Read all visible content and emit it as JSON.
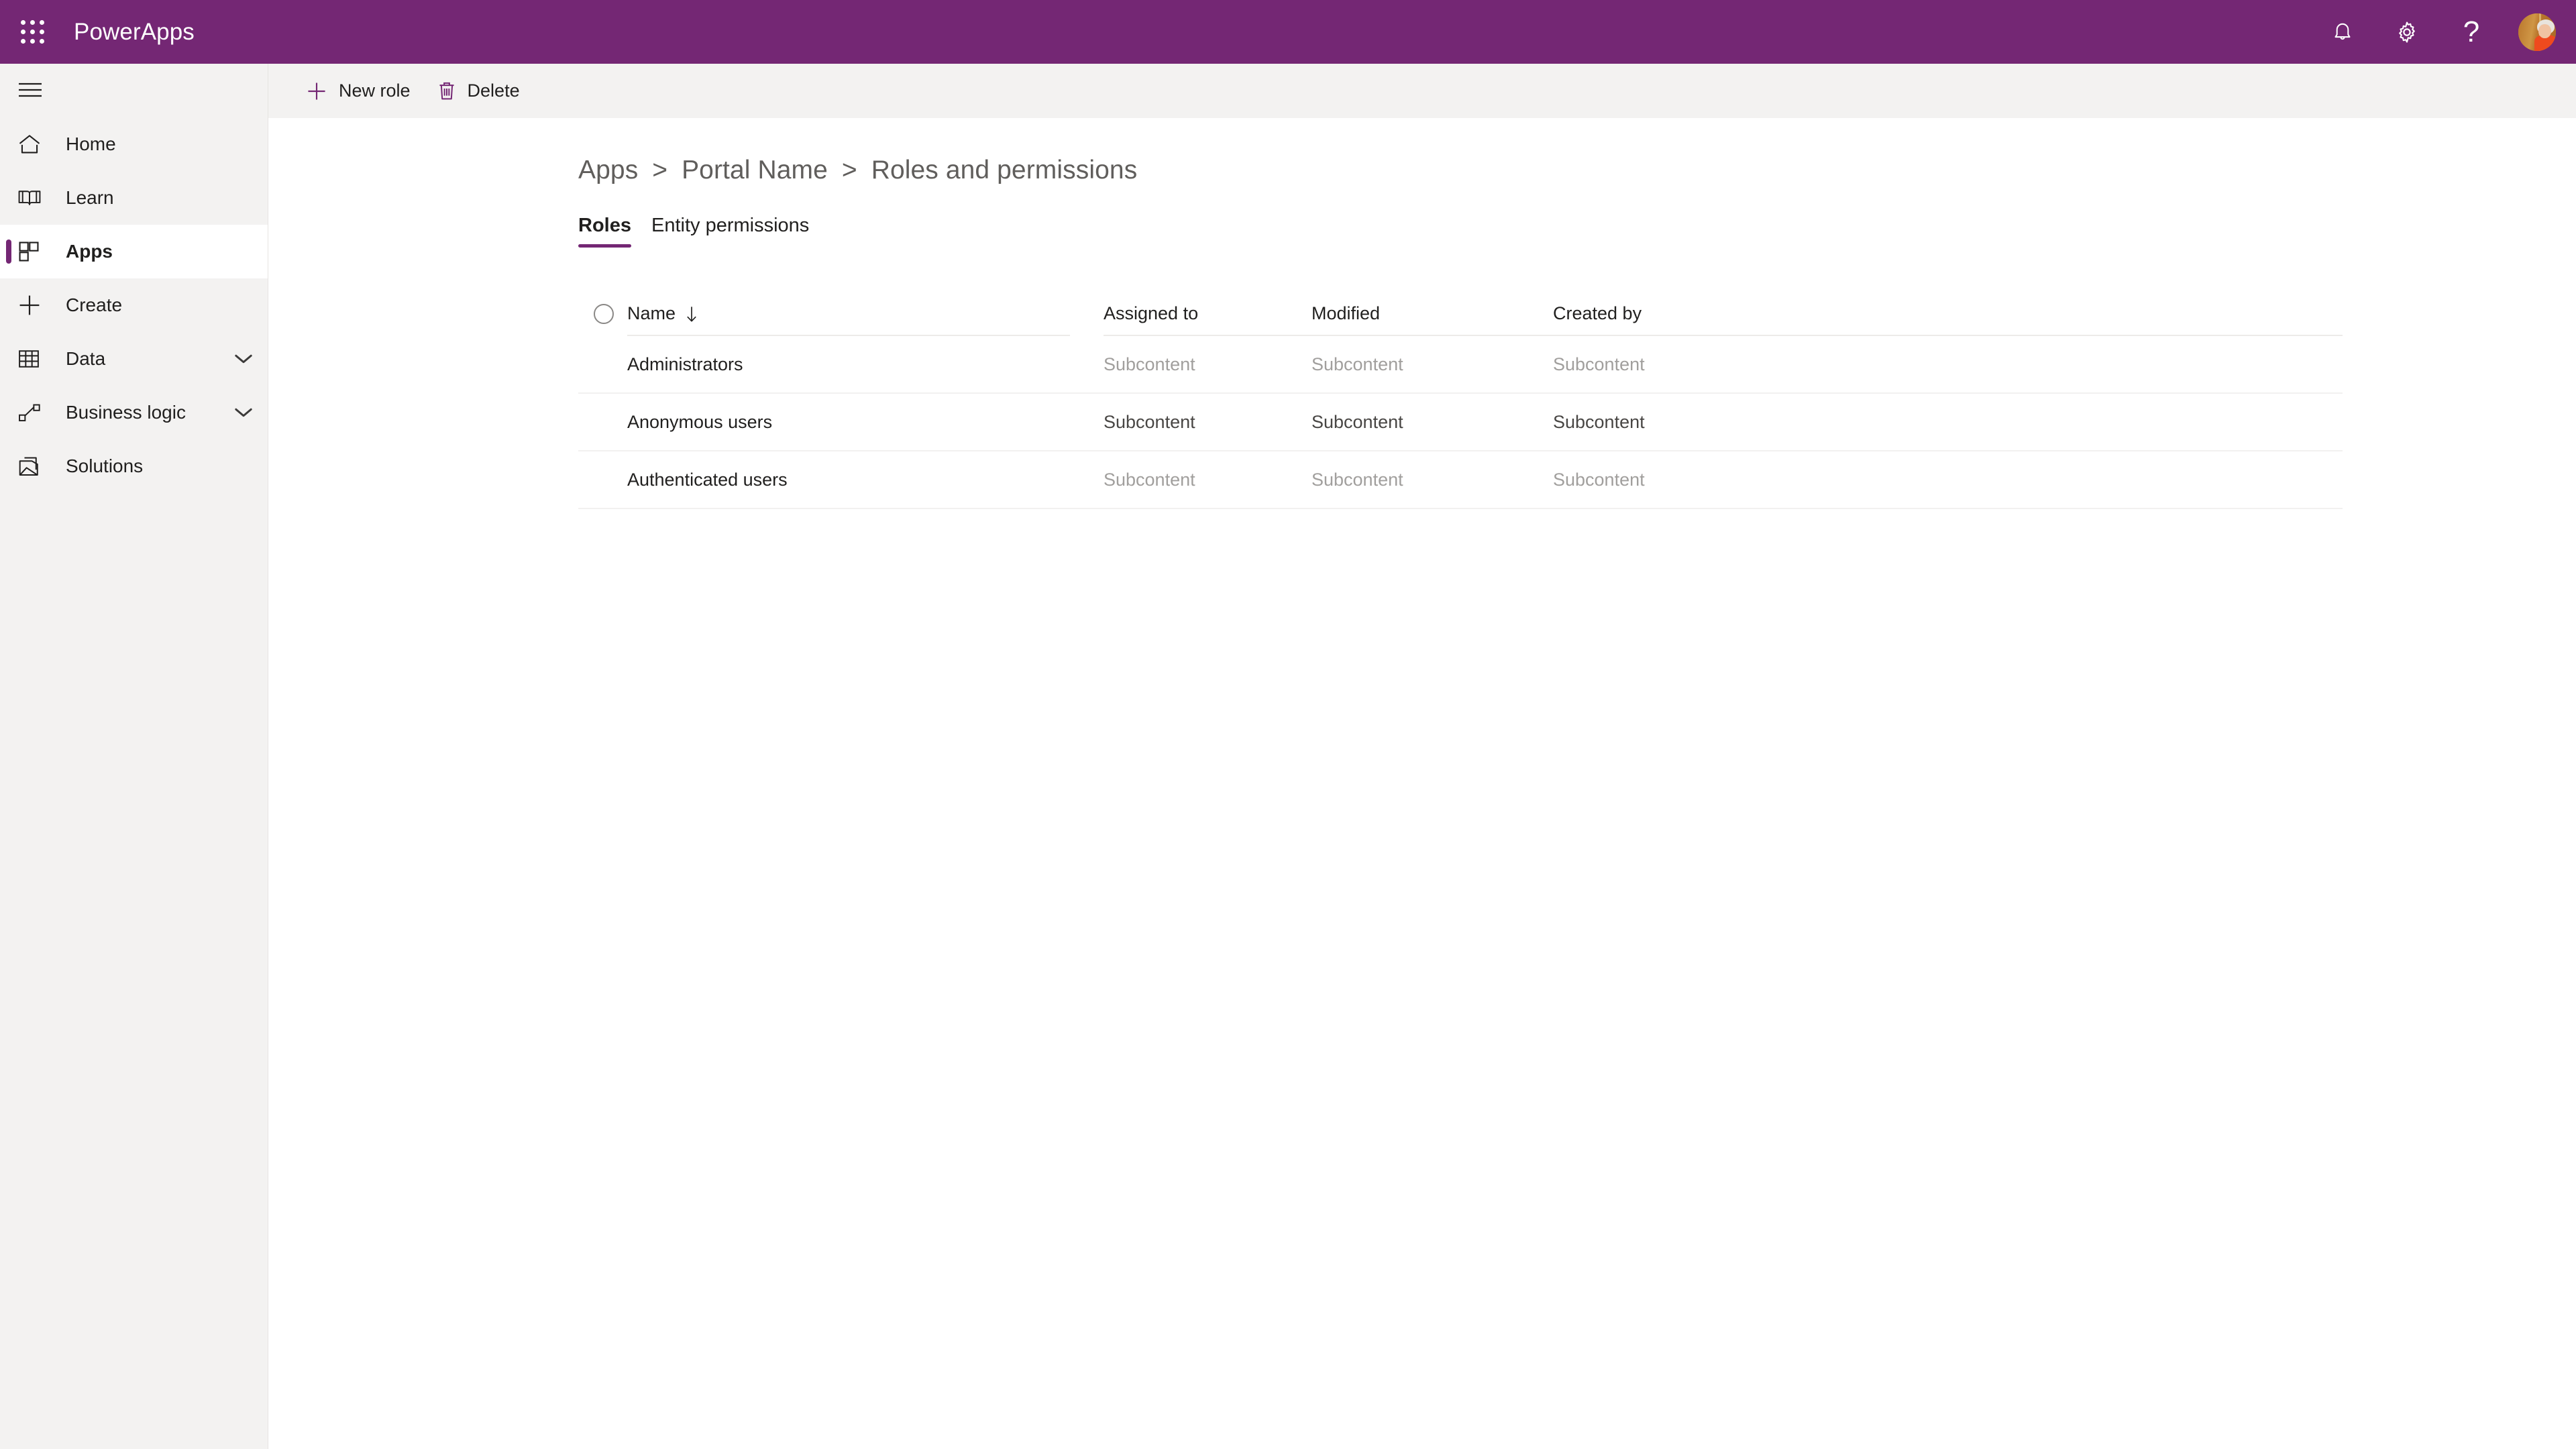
{
  "topbar": {
    "waffle_icon": "waffle-grid-icon",
    "brand": "PowerApps",
    "notifications_icon": "bell-icon",
    "settings_icon": "gear-icon",
    "help_icon": "question-mark-icon",
    "help_glyph": "?",
    "avatar_icon": "user-avatar",
    "background_color": "#742774"
  },
  "sidebar": {
    "menu_toggle_icon": "hamburger-icon",
    "background_color": "#f3f2f1",
    "accent_color": "#742774",
    "items": [
      {
        "label": "Home",
        "icon": "home-icon",
        "selected": false,
        "expandable": false
      },
      {
        "label": "Learn",
        "icon": "book-icon",
        "selected": false,
        "expandable": false
      },
      {
        "label": "Apps",
        "icon": "apps-grid-icon",
        "selected": true,
        "expandable": false
      },
      {
        "label": "Create",
        "icon": "plus-icon",
        "selected": false,
        "expandable": false
      },
      {
        "label": "Data",
        "icon": "table-icon",
        "selected": false,
        "expandable": true
      },
      {
        "label": "Business logic",
        "icon": "flow-icon",
        "selected": false,
        "expandable": true
      },
      {
        "label": "Solutions",
        "icon": "solutions-icon",
        "selected": false,
        "expandable": false
      }
    ]
  },
  "command_bar": {
    "new_role_label": "New role",
    "new_role_icon": "plus-icon",
    "delete_label": "Delete",
    "delete_icon": "trash-icon",
    "icon_color": "#742774"
  },
  "breadcrumb": {
    "crumb1": "Apps",
    "sep1": ">",
    "crumb2": "Portal Name",
    "sep2": ">",
    "crumb3": "Roles and permissions"
  },
  "tabs": [
    {
      "label": "Roles",
      "active": true
    },
    {
      "label": "Entity permissions",
      "active": false
    }
  ],
  "table": {
    "select_all_icon": "select-all-circle",
    "sort_icon": "arrow-down-icon",
    "columns": [
      "Name",
      "Assigned to",
      "Modified",
      "Created by"
    ],
    "rows": [
      {
        "name": "Administrators",
        "assigned_to": "Subcontent",
        "modified": "Subcontent",
        "created_by": "Subcontent",
        "emphasis": false
      },
      {
        "name": "Anonymous users",
        "assigned_to": "Subcontent",
        "modified": "Subcontent",
        "created_by": "Subcontent",
        "emphasis": true
      },
      {
        "name": "Authenticated users",
        "assigned_to": "Subcontent",
        "modified": "Subcontent",
        "created_by": "Subcontent",
        "emphasis": false
      }
    ]
  }
}
